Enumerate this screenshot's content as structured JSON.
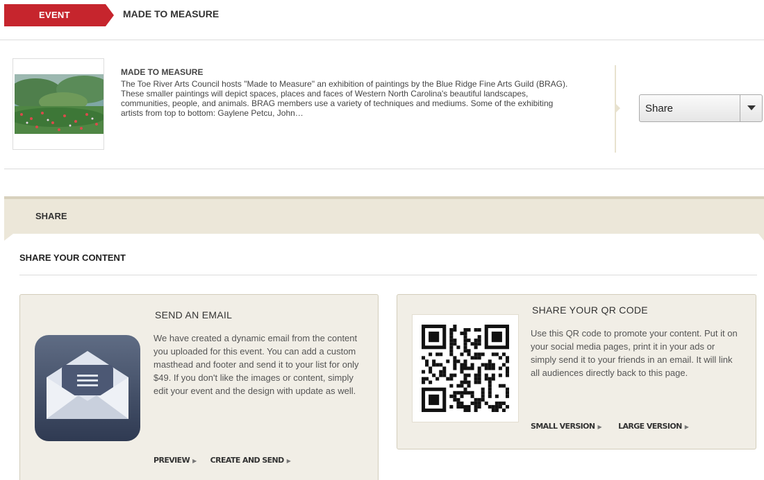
{
  "header": {
    "tag": "EVENT",
    "title": "MADE TO MEASURE"
  },
  "event": {
    "title": "MADE TO MEASURE",
    "description": "The Toe River Arts Council hosts \"Made to Measure\" an exhibition of paintings by the Blue Ridge Fine Arts Guild (BRAG). These smaller paintings will depict spaces, places and faces of Western North Carolina's beautiful landscapes, communities, people, and animals. BRAG members use a variety of techniques and mediums. Some of the exhibiting artists from top to bottom: Gaylene Petcu, John…",
    "share_select": "Share"
  },
  "share_tab": {
    "label": "SHARE"
  },
  "share_content": {
    "heading": "SHARE YOUR CONTENT"
  },
  "email_card": {
    "title": "SEND AN EMAIL",
    "text": "We have created a dynamic email from the content you uploaded for this event. You can add a custom masthead and footer and send it to your list for only $49. If you don't like the images or content, simply edit your event and the design with update as well.",
    "links": [
      "PREVIEW",
      "CREATE AND SEND"
    ]
  },
  "qr_card": {
    "title": "SHARE YOUR QR CODE",
    "text": "Use this QR code to promote your content. Put it on your social media pages, print it in your ads or simply send it to your friends in an email. It will link all audiences directly back to this page.",
    "links": [
      "SMALL VERSION",
      "LARGE VERSION"
    ]
  },
  "colors": {
    "accent": "#c6252d",
    "card_bg": "#f1eee6",
    "tab_bg": "#ece7d9"
  }
}
